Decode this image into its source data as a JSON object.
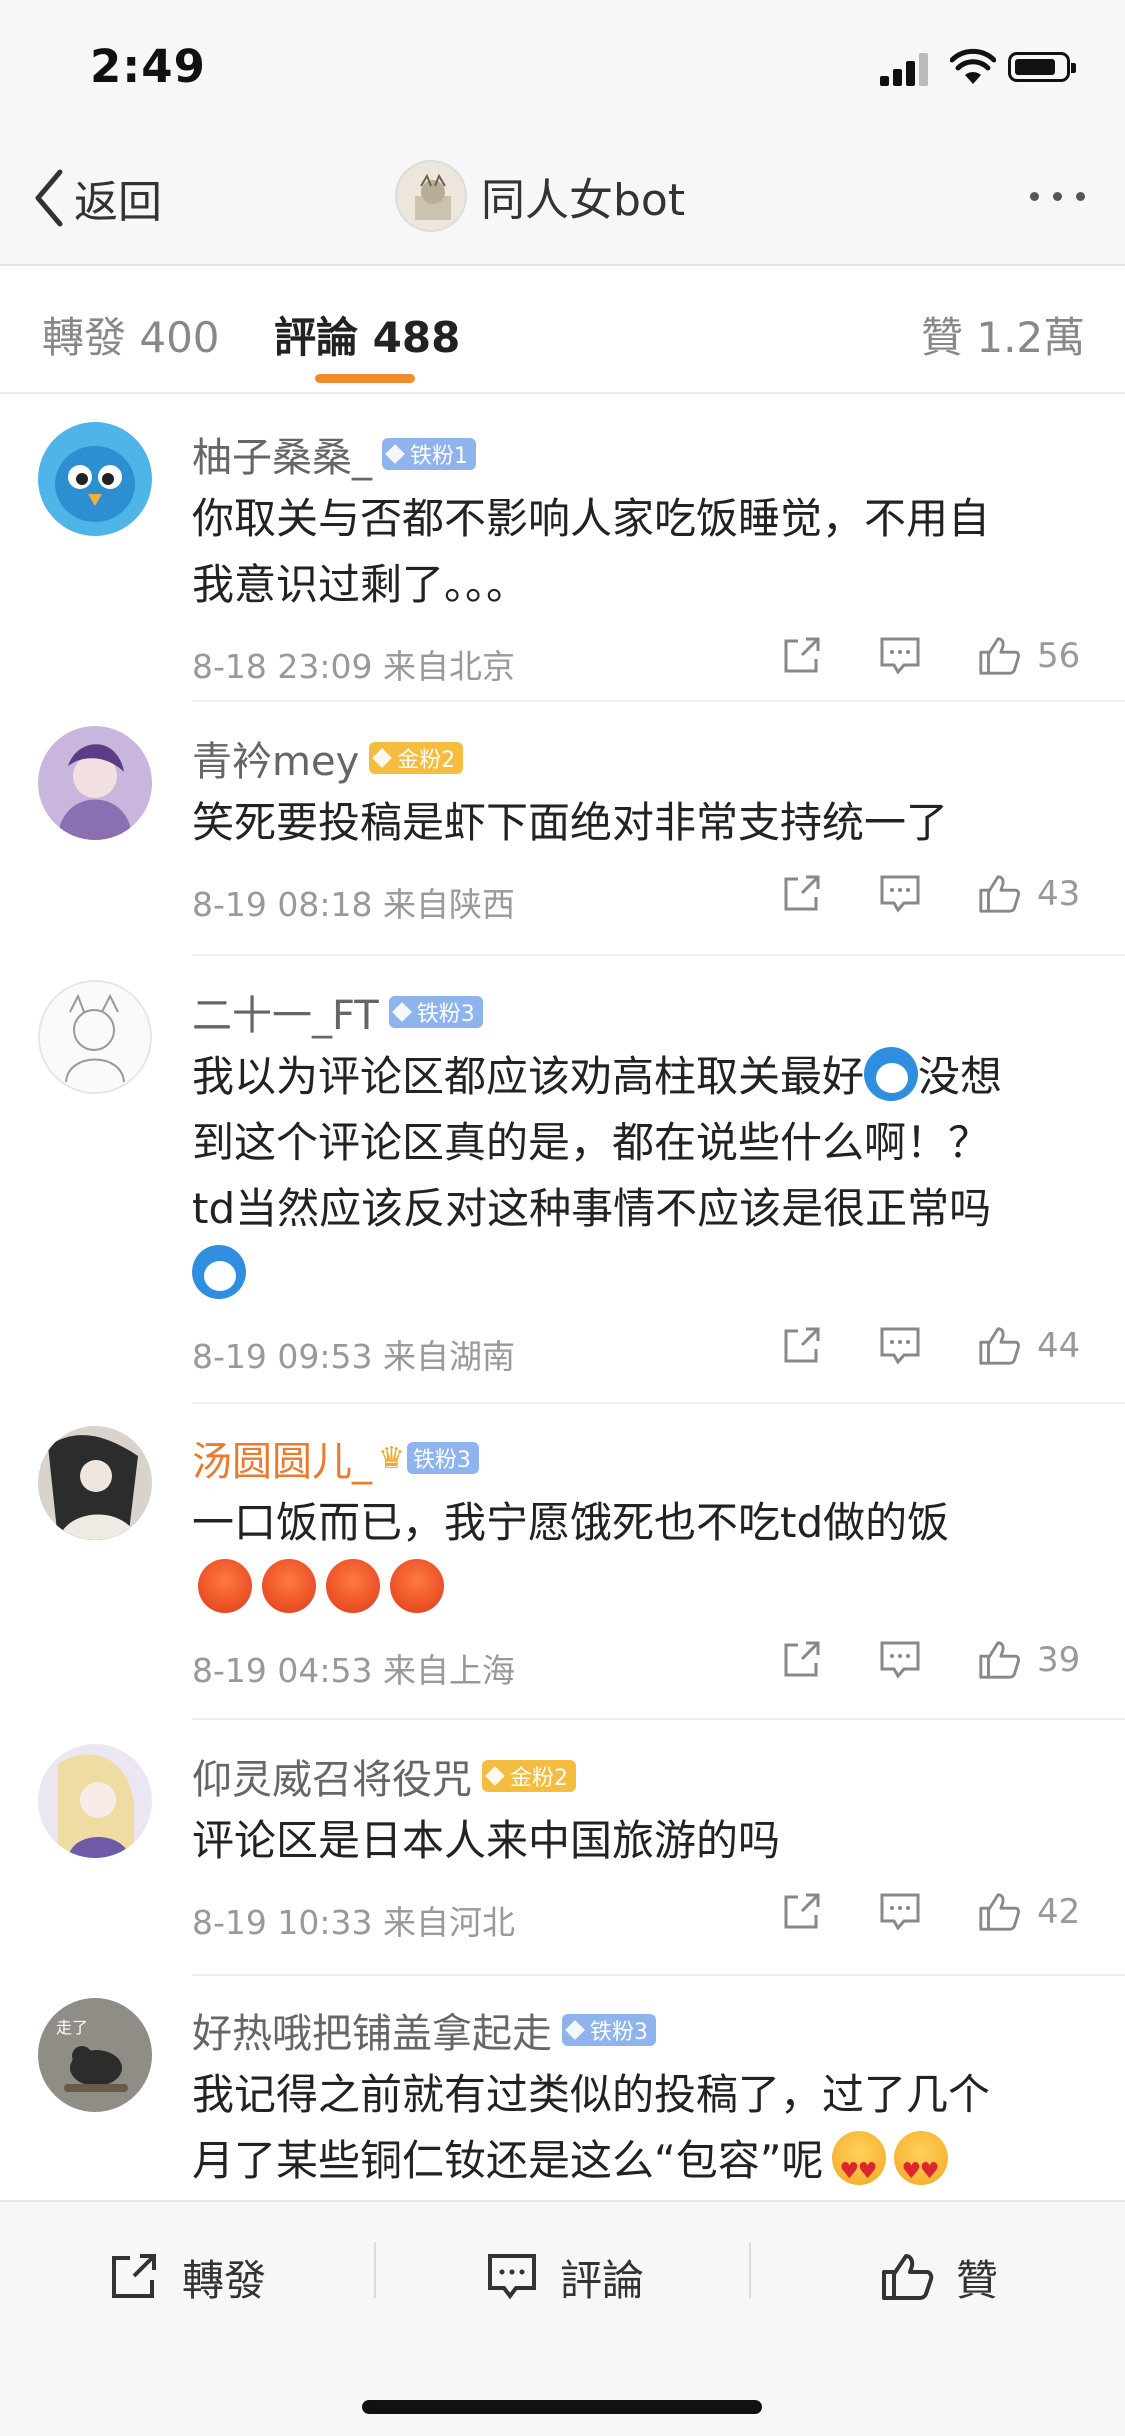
{
  "status_bar": {
    "time": "2:49"
  },
  "nav": {
    "back_label": "返回",
    "title": "同人女bot"
  },
  "tabs": {
    "repost": "轉發 400",
    "comments": "評論 488",
    "likes": "贊 1.2萬"
  },
  "comments": [
    {
      "name": "柚子桑桑_",
      "badge": "铁粉1",
      "badge_type": "iron",
      "text_lines": [
        "你取关与否都不影响人家吃饭睡觉，不用自",
        "我意识过剩了。。。"
      ],
      "meta": "8-18 23:09  来自北京",
      "likes": "56"
    },
    {
      "name": "青衿mey",
      "badge": "金粉2",
      "badge_type": "gold",
      "text_lines": [
        "笑死要投稿是虾下面绝对非常支持统一了"
      ],
      "meta": "8-19 08:18  来自陕西",
      "likes": "43"
    },
    {
      "name": "二十一_FT",
      "badge": "铁粉3",
      "badge_type": "iron",
      "text_lines": [
        "我以为评论区都应该劝高柱取关最好",
        "没想",
        "到这个评论区真的是，都在说些什么啊！？",
        "td当然应该反对这种事情不应该是很正常吗"
      ],
      "meta": "8-19 09:53  来自湖南",
      "likes": "44"
    },
    {
      "name": "汤圆圆儿_",
      "badge": "铁粉3",
      "badge_type": "iron",
      "text_lines": [
        "一口饭而已，我宁愿饿死也不吃td做的饭"
      ],
      "meta": "8-19 04:53  来自上海",
      "likes": "39"
    },
    {
      "name": "仰灵威召将役咒",
      "badge": "金粉2",
      "badge_type": "gold",
      "text_lines": [
        "评论区是日本人来中国旅游的吗"
      ],
      "meta": "8-19 10:33  来自河北",
      "likes": "42"
    },
    {
      "name": "好热哦把铺盖拿起走",
      "badge": "铁粉3",
      "badge_type": "iron",
      "text_lines": [
        "我记得之前就有过类似的投稿了，过了几个",
        "月了某些铜仁钕还是这么“包容”呢"
      ],
      "avatar_text": "走了"
    }
  ],
  "bottom_bar": {
    "repost": "轉發",
    "comment": "評論",
    "like": "贊"
  },
  "colors": {
    "accent_orange": "#f08c2c",
    "iron_badge": "#8fb3ec",
    "gold_badge": "#f4bd3f",
    "vip_name": "#eb7a2e"
  }
}
